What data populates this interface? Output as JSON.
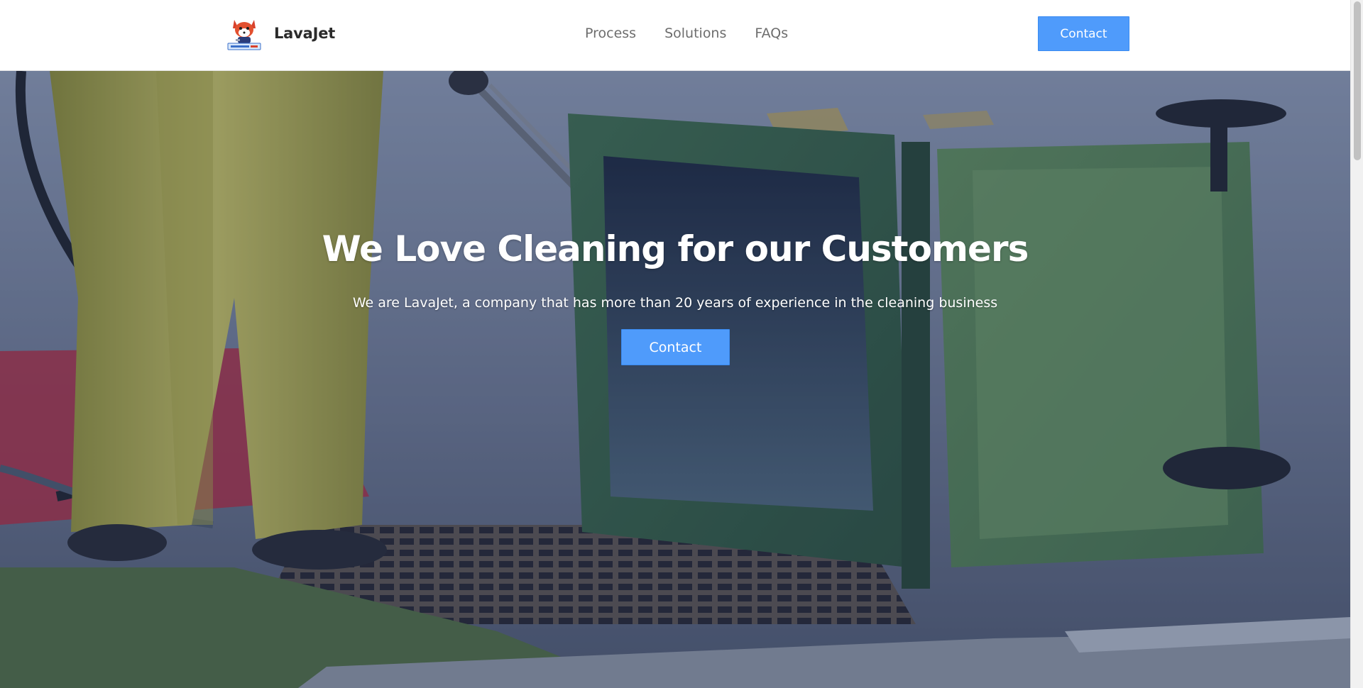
{
  "header": {
    "brand_name": "LavaJet",
    "nav": {
      "process": "Process",
      "solutions": "Solutions",
      "faqs": "FAQs"
    },
    "contact_label": "Contact"
  },
  "hero": {
    "title": "We Love Cleaning for our Customers",
    "subtitle": "We are LavaJet, a company that has more than 20 years of experience in the cleaning business",
    "contact_label": "Contact"
  },
  "colors": {
    "accent": "#4f9bfb",
    "nav_text": "#6d6d6d",
    "brand_text": "#2b2b2b"
  }
}
